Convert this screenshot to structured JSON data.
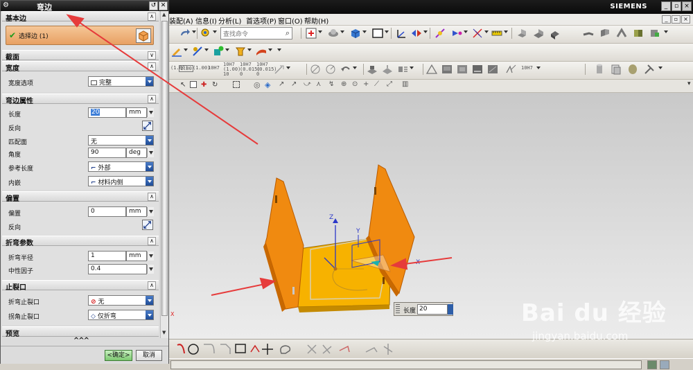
{
  "app": {
    "brand": "SIEMENS",
    "window_buttons": [
      "_",
      "▫",
      "×"
    ],
    "mdi_buttons": [
      "_",
      "▫",
      "×"
    ]
  },
  "menu": {
    "items": [
      "装配(A)",
      "信息(I)",
      "分析(L)",
      "首选项(P)",
      "窗口(O)",
      "帮助(H)"
    ]
  },
  "toolbar": {
    "search_placeholder": "查找命令",
    "dim_labels": [
      "(1.00)",
      "1.00",
      "(1.00)",
      "10H7",
      "10H7 (1.00) 10",
      "10H7 (0.015) 0",
      "10H7 (0.015) 0",
      "10H7"
    ]
  },
  "dialog": {
    "title": "弯边",
    "sections": {
      "base_edge": {
        "title": "基本边",
        "select_label": "选择边 (1)"
      },
      "profile": {
        "title": "截面"
      },
      "width": {
        "title": "宽度",
        "option_label": "宽度选项",
        "option_value": "完整"
      },
      "flange_props": {
        "title": "弯边属性",
        "length_label": "长度",
        "length_value": "20",
        "length_unit": "mm",
        "reverse_label": "反向",
        "match_face_label": "匹配面",
        "match_face_value": "无",
        "angle_label": "角度",
        "angle_value": "90",
        "angle_unit": "deg",
        "ref_length_label": "参考长度",
        "ref_length_value": "外部",
        "inset_label": "内嵌",
        "inset_value": "材料内侧"
      },
      "offset": {
        "title": "偏置",
        "offset_label": "偏置",
        "offset_value": "0",
        "offset_unit": "mm",
        "reverse_label": "反向"
      },
      "bend_params": {
        "title": "折弯参数",
        "radius_label": "折弯半径",
        "radius_value": "1",
        "radius_unit": "mm",
        "neutral_label": "中性因子",
        "neutral_value": "0.4"
      },
      "relief": {
        "title": "止裂口",
        "bend_relief_label": "折弯止裂口",
        "bend_relief_value": "无",
        "corner_relief_label": "拐角止裂口",
        "corner_relief_value": "仅折弯"
      },
      "preview": {
        "title": "预览"
      }
    },
    "more": "^^^",
    "ok_label": "<确定>",
    "cancel_label": "取消"
  },
  "viewport": {
    "axis_labels": {
      "z": "Z",
      "y": "Y",
      "x": "X",
      "ghost_x": "X"
    },
    "length_popup": {
      "label": "长度",
      "value": "20"
    }
  },
  "watermark": {
    "logo": "Bai du 经验",
    "url": "jingyan.baidu.com"
  },
  "colors": {
    "panel_orange": "#f08a10",
    "panel_edge": "#b85a00",
    "base_yellow": "#f7b200",
    "arrow_red": "#e63b3b",
    "title_black": "#0f0f0f"
  }
}
